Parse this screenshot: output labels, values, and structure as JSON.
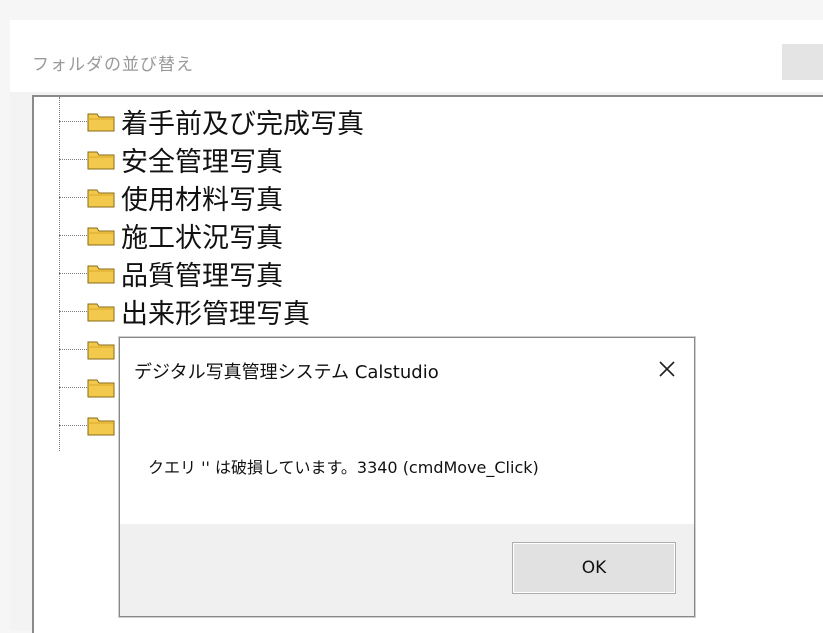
{
  "window": {
    "title": "フォルダの並び替え"
  },
  "tree": {
    "folders": [
      {
        "label": "着手前及び完成写真"
      },
      {
        "label": "安全管理写真"
      },
      {
        "label": "使用材料写真"
      },
      {
        "label": "施工状況写真"
      },
      {
        "label": "品質管理写真"
      },
      {
        "label": "出来形管理写真"
      },
      {
        "label": ""
      },
      {
        "label": ""
      },
      {
        "label": ""
      }
    ]
  },
  "dialog": {
    "title": "デジタル写真管理システム Calstudio",
    "message": "クエリ '' は破損しています。3340 (cmdMove_Click)",
    "ok_label": "OK",
    "close_icon": "close-x-icon"
  },
  "colors": {
    "folder_fill": "#f2c94c",
    "folder_stroke": "#8a6a1a",
    "window_bg": "#f3f3f3",
    "panel_bg": "#ffffff"
  }
}
